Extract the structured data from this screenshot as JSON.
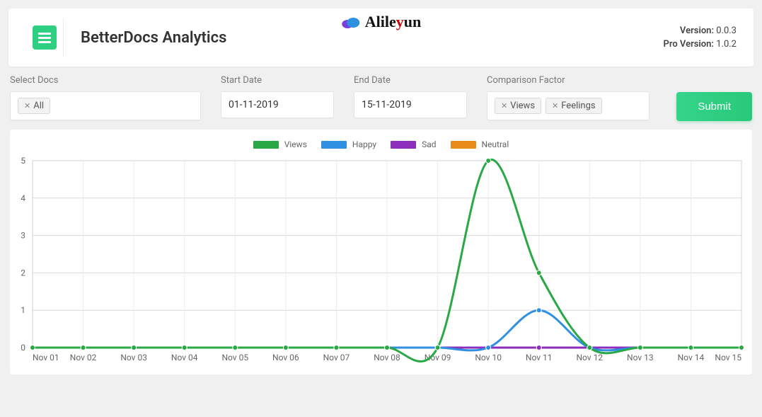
{
  "header": {
    "title": "BetterDocs Analytics",
    "brand": "Alileyun",
    "version_label": "Version:",
    "version": "0.0.3",
    "pro_version_label": "Pro Version:",
    "pro_version": "1.0.2"
  },
  "filters": {
    "select_docs_label": "Select Docs",
    "docs_chip": "All",
    "start_date_label": "Start Date",
    "start_date": "01-11-2019",
    "end_date_label": "End Date",
    "end_date": "15-11-2019",
    "comparison_label": "Comparison Factor",
    "comparison_chips": [
      "Views",
      "Feelings"
    ],
    "submit_label": "Submit"
  },
  "legend": {
    "views": "Views",
    "happy": "Happy",
    "sad": "Sad",
    "neutral": "Neutral"
  },
  "colors": {
    "views": "#29a845",
    "happy": "#2f8fe0",
    "sad": "#8d2dbb",
    "neutral": "#e88b1a"
  },
  "chart_data": {
    "type": "line",
    "xlabel": "",
    "ylabel": "",
    "ylim": [
      0,
      5
    ],
    "categories": [
      "Nov 01",
      "Nov 02",
      "Nov 03",
      "Nov 04",
      "Nov 05",
      "Nov 06",
      "Nov 07",
      "Nov 08",
      "Nov 09",
      "Nov 10",
      "Nov 11",
      "Nov 12",
      "Nov 13",
      "Nov 14",
      "Nov 15"
    ],
    "series": [
      {
        "name": "Views",
        "color": "#29a845",
        "values": [
          0,
          0,
          0,
          0,
          0,
          0,
          0,
          0,
          0,
          5,
          2,
          0,
          0,
          0,
          0
        ]
      },
      {
        "name": "Happy",
        "color": "#2f8fe0",
        "values": [
          0,
          0,
          0,
          0,
          0,
          0,
          0,
          0,
          0,
          0,
          1,
          0,
          0,
          0,
          0
        ]
      },
      {
        "name": "Sad",
        "color": "#8d2dbb",
        "values": [
          0,
          0,
          0,
          0,
          0,
          0,
          0,
          0,
          0,
          0,
          0,
          0,
          0,
          0,
          0
        ]
      },
      {
        "name": "Neutral",
        "color": "#e88b1a",
        "values": [
          0,
          0,
          0,
          0,
          0,
          0,
          0,
          0,
          0,
          0,
          0,
          0,
          0,
          0,
          0
        ]
      }
    ]
  }
}
